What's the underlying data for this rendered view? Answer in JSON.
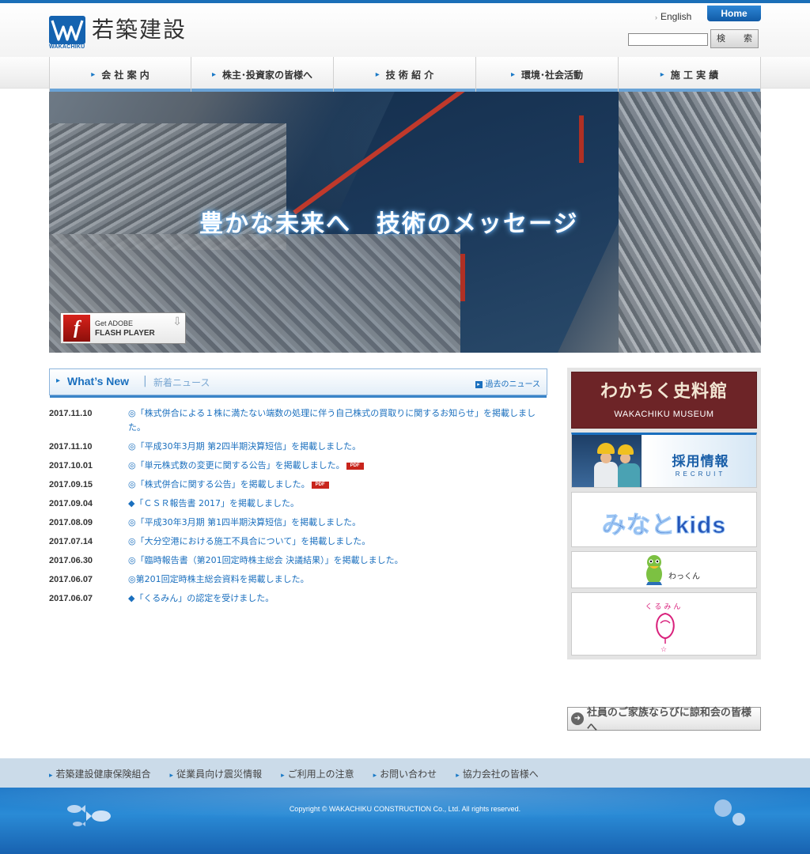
{
  "header": {
    "logo_text": "若築建設",
    "logo_sub": "WAKACHIKU",
    "english": "English",
    "home": "Home",
    "search_button": "検　索"
  },
  "nav": [
    {
      "label": "会 社 案 内"
    },
    {
      "label": "株主･投資家の皆様へ"
    },
    {
      "label": "技 術 紹 介"
    },
    {
      "label": "環境･社会活動"
    },
    {
      "label": "施 工 実 績"
    }
  ],
  "hero": {
    "text": "豊かな未来へ　技術のメッセージ",
    "flash_get": "Get ADOBE",
    "flash_player": "FLASH PLAYER"
  },
  "news": {
    "title": "What’s New",
    "title_jp": "新着ニュース",
    "past": "過去のニュース",
    "items": [
      {
        "date": "2017.11.10",
        "text": "◎「株式併合による１株に満たない端数の処理に伴う自己株式の買取りに関するお知らせ」を掲載しました。"
      },
      {
        "date": "2017.11.10",
        "text": "◎「平成30年3月期 第2四半期決算短信」を掲載しました。"
      },
      {
        "date": "2017.10.01",
        "text": "◎「単元株式数の変更に関する公告」を掲載しました。"
      },
      {
        "date": "2017.09.15",
        "text": "◎「株式併合に関する公告」を掲載しました。"
      },
      {
        "date": "2017.09.04",
        "text": "◆「ＣＳＲ報告書 2017」を掲載しました。"
      },
      {
        "date": "2017.08.09",
        "text": "◎「平成30年3月期 第1四半期決算短信」を掲載しました。"
      },
      {
        "date": "2017.07.14",
        "text": "◎「大分空港における施工不具合について」を掲載しました。"
      },
      {
        "date": "2017.06.30",
        "text": "◎「臨時報告書（第201回定時株主総会 決議結果）」を掲載しました。"
      },
      {
        "date": "2017.06.07",
        "text": "◎第201回定時株主総会資料を掲載しました。"
      },
      {
        "date": "2017.06.07",
        "text": "◆「くるみん」の認定を受けました。"
      }
    ],
    "pdf_label": "PDF"
  },
  "sidebar": {
    "museum_jp": "わかちく史料館",
    "museum_en": "WAKACHIKU MUSEUM",
    "recruit_jp": "採用情報",
    "recruit_en": "RECRUIT",
    "kids": "みなとkids",
    "wakkun": "わっくん",
    "kurumin": "くるみん"
  },
  "family_button": "社員のご家族ならびに諒和会の皆様へ",
  "footer": {
    "links": [
      "若築建設健康保険組合",
      "従業員向け震災情報",
      "ご利用上の注意",
      "お問い合わせ",
      "協力会社の皆様へ"
    ],
    "copyright": "Copyright © WAKACHIKU CONSTRUCTION Co., Ltd. All rights reserved."
  },
  "colors": {
    "brand_blue": "#1a6fbe",
    "museum_bg": "#6d2427",
    "pdf_red": "#c8251c"
  }
}
